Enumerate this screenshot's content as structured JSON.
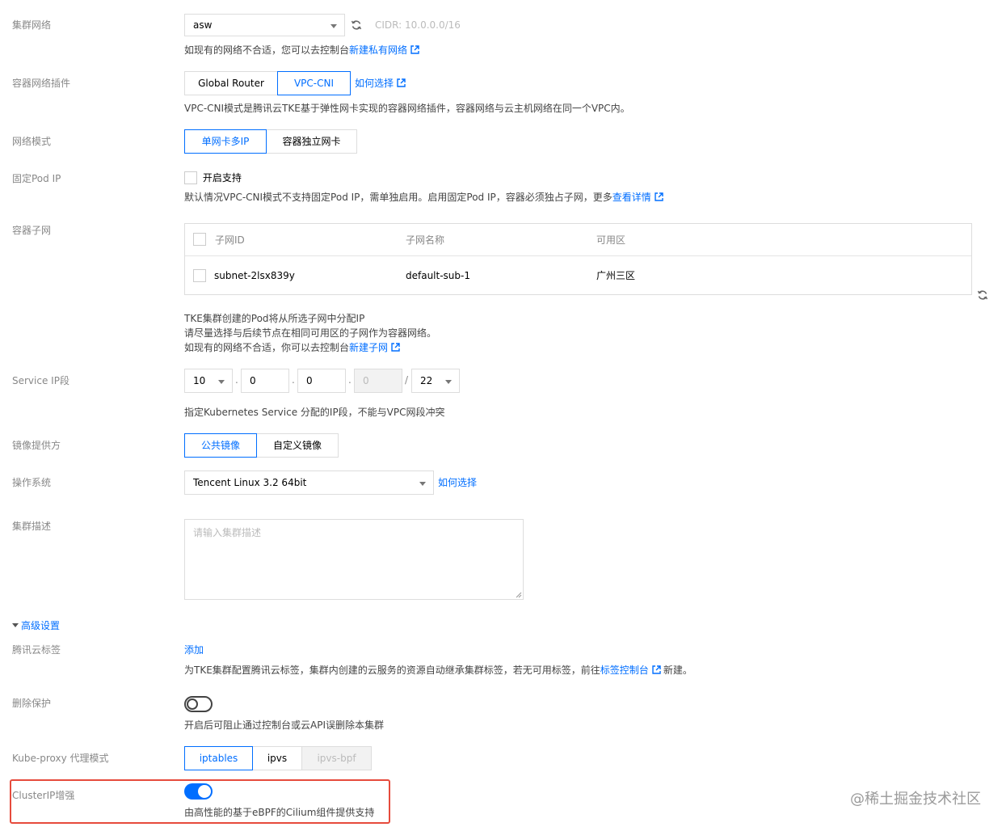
{
  "cluster_network": {
    "label": "集群网络",
    "select_value": "asw",
    "cidr": "CIDR: 10.0.0.0/16",
    "desc_prefix": "如现有的网络不合适，您可以去控制台",
    "desc_link": "新建私有网络"
  },
  "network_plugin": {
    "label": "容器网络插件",
    "options": [
      "Global Router",
      "VPC-CNI"
    ],
    "selected": "VPC-CNI",
    "how_link": "如何选择",
    "desc": "VPC-CNI模式是腾讯云TKE基于弹性网卡实现的容器网络插件，容器网络与云主机网络在同一个VPC内。"
  },
  "network_mode": {
    "label": "网络模式",
    "options": [
      "单网卡多IP",
      "容器独立网卡"
    ],
    "selected": "单网卡多IP"
  },
  "fixed_pod_ip": {
    "label": "固定Pod IP",
    "checkbox_label": "开启支持",
    "desc_prefix": "默认情况VPC-CNI模式不支持固定Pod IP，需单独启用。启用固定Pod IP，容器必须独占子网，更多",
    "desc_link": "查看详情"
  },
  "container_subnet": {
    "label": "容器子网",
    "columns": [
      "子网ID",
      "子网名称",
      "可用区"
    ],
    "rows": [
      {
        "id": "subnet-2lsx839y",
        "name": "default-sub-1",
        "zone": "广州三区"
      }
    ],
    "desc_line1": "TKE集群创建的Pod将从所选子网中分配IP",
    "desc_line2": "请尽量选择与后续节点在相同可用区的子网作为容器网络。",
    "desc_line3_prefix": "如现有的网络不合适，你可以去控制台",
    "desc_line3_link": "新建子网"
  },
  "service_ip": {
    "label": "Service IP段",
    "octet1": "10",
    "octet2": "0",
    "octet3": "0",
    "octet4": "0",
    "mask": "22",
    "dot": ".",
    "slash": "/",
    "desc": "指定Kubernetes Service 分配的IP段，不能与VPC网段冲突"
  },
  "image_provider": {
    "label": "镜像提供方",
    "options": [
      "公共镜像",
      "自定义镜像"
    ],
    "selected": "公共镜像"
  },
  "os": {
    "label": "操作系统",
    "select_value": "Tencent Linux 3.2 64bit",
    "how_link": "如何选择"
  },
  "cluster_desc": {
    "label": "集群描述",
    "placeholder": "请输入集群描述"
  },
  "advanced": {
    "toggle_label": "高级设置"
  },
  "tags": {
    "label": "腾讯云标签",
    "add_link": "添加",
    "desc_prefix": "为TKE集群配置腾讯云标签，集群内创建的云服务的资源自动继承集群标签，若无可用标签，前往",
    "desc_link": "标签控制台",
    "desc_suffix": "新建。"
  },
  "delete_protect": {
    "label": "删除保护",
    "enabled": false,
    "desc": "开启后可阻止通过控制台或云API误删除本集群"
  },
  "kube_proxy": {
    "label": "Kube-proxy 代理模式",
    "options": [
      "iptables",
      "ipvs",
      "ipvs-bpf"
    ],
    "selected": "iptables",
    "disabled": "ipvs-bpf"
  },
  "clusterip": {
    "label": "ClusterIP增强",
    "enabled": true,
    "desc": "由高性能的基于eBPF的Cilium组件提供支持"
  },
  "watermark": "@稀土掘金技术社区",
  "colors": {
    "accent": "#006eff",
    "highlight": "#e64b3c",
    "label": "#888888"
  }
}
